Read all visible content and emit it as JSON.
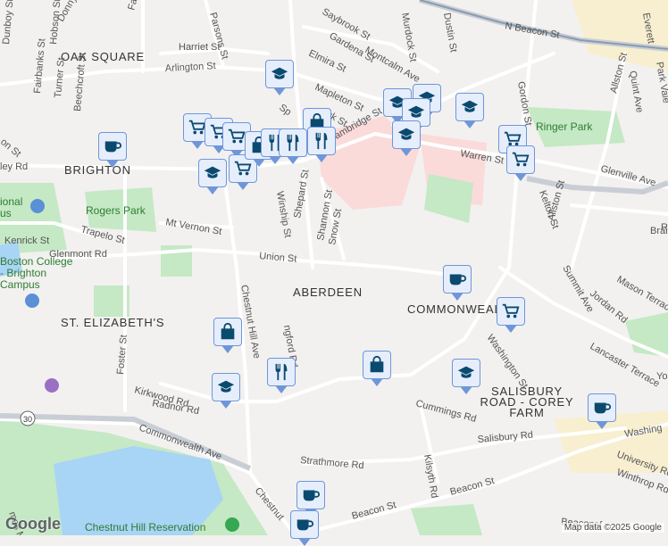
{
  "colors": {
    "marker_bg": "#e6eefc",
    "marker_border": "#6f96d8",
    "icon": "#0b4a6f",
    "park": "#c5e8c5",
    "water": "#a8d4f5",
    "hospital": "#fbdada"
  },
  "areas": {
    "oak_square": "OAK SQUARE",
    "brighton": "BRIGHTON",
    "aberdeen": "ABERDEEN",
    "commonwealth": "COMMONWEALTH",
    "st_elizabeths": "ST. ELIZABETH'S",
    "salisbury1": "SALISBURY",
    "salisbury2": "ROAD - COREY",
    "salisbury3": "FARM"
  },
  "parks": {
    "ringer": "Ringer Park",
    "rogers": "Rogers Park",
    "reservation": "Chestnut Hill Reservation",
    "bc1": "Boston College",
    "bc2": "- Brighton",
    "bc3": "Campus",
    "national1": "ional",
    "national2": "us"
  },
  "streets": [
    "Donnybrook Rd",
    "Faneuil St",
    "Parsons St",
    "Saybrook St",
    "Murdock St",
    "Dustin St",
    "N Beacon St",
    "Everett",
    "Harriet St",
    "Gardena St",
    "Montcalm Ave",
    "Elmira St",
    "Arlington St",
    "Hobson St",
    "Dunboy St",
    "Mapleton St",
    "Park Vale",
    "Quint Ave",
    "Allston St",
    "Gordon St",
    "Warren St",
    "Glenville Ave",
    "Cambridge St",
    "Kelton St",
    "Fairbanks St",
    "Turner St",
    "Beechcroft St",
    "Winship St",
    "Shepard St",
    "Shannon St",
    "Snow St",
    "Mt Vernon St",
    "Kenrick St",
    "Trapelo St",
    "Glenmont Rd",
    "Union St",
    "Allston St",
    "Brain",
    "Summit Ave",
    "Chestnut Hill Ave",
    "Mason Terrace",
    "Jordan Rd",
    "Washington St",
    "Lancaster Terrace",
    "ngford Rd",
    "Kirkwood Rd",
    "Radnor Rd",
    "Foster St",
    "Cummings Rd",
    "Commonwealth Ave",
    "Strathmore Rd",
    "Kilsyth Rd",
    "Salisbury Rd",
    "Washing",
    "University Rd",
    "Winthrop Rd",
    "Beacon St",
    "Beacon St",
    "Beaconsf",
    "Chestnut",
    "mas More Rd",
    "ley Rd",
    "on St",
    "Sp",
    "ck St",
    "Yor",
    "Ro"
  ],
  "route_shield": "30",
  "attribution": "Map data ©2025 Google",
  "google_logo": "Google"
}
